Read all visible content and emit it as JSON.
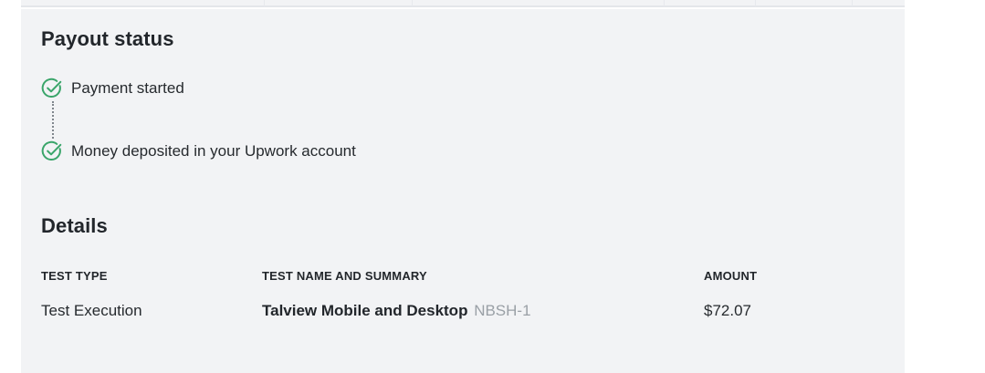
{
  "payout": {
    "title": "Payout status",
    "steps": [
      {
        "label": "Payment started",
        "icon": "check-circle-icon",
        "status": "complete"
      },
      {
        "label": "Money deposited in your Upwork account",
        "icon": "check-circle-icon",
        "status": "complete"
      }
    ],
    "accent_color": "#3aa56a"
  },
  "details": {
    "title": "Details",
    "columns": [
      "TEST TYPE",
      "TEST NAME AND SUMMARY",
      "AMOUNT"
    ],
    "rows": [
      {
        "test_type": "Test Execution",
        "test_name": "Talview Mobile and Desktop",
        "test_code": "NBSH-1",
        "amount": "$72.07"
      }
    ]
  },
  "colors": {
    "panel_background": "#f2f3f5",
    "text": "#262a2e",
    "muted_text": "#9aa0a6"
  }
}
